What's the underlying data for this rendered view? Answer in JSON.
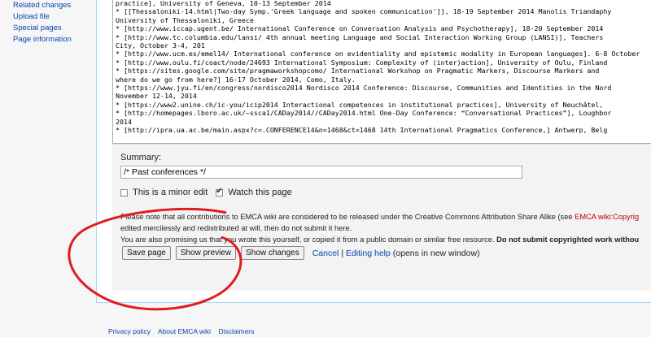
{
  "sidebar": {
    "items": [
      {
        "label": "Related changes"
      },
      {
        "label": "Upload file"
      },
      {
        "label": "Special pages"
      },
      {
        "label": "Page information"
      }
    ]
  },
  "editor": {
    "lines": [
      "practice], University of Geneva, 10-13 September 2014",
      "* [[Thessaloniki-14.html|Two-day Symp.'Greek language and spoken communication']], 18-19 September 2014 Manolis Triandaphy",
      "University of Thessaloniki, Greece",
      "* [http://www.iccap.ugent.be/ International Conference on Conversation Analysis and Psychotherapy], 18-20 September 2014",
      "* [http://www.tc.columbia.edu/lansi/ 4th annual meeting Language and Social Interaction Working Group (LANSI)], Teachers",
      "City, October 3-4, 201",
      "* [http://www.ucm.es/emel14/ International conference on evidentiality and epistemic modality in European languages]. 6-8 October",
      "* [http://www.oulu.fi/coact/node/24693 International Symposium: Complexity of (inter)action], University of Oulu, Finland",
      "* [https://sites.google.com/site/pragmaworkshopcomo/ International Workshop on Pragmatic Markers, Discourse Markers and",
      "where do we go from here?] 16-17 October 2014, Como, Italy.",
      "* [https://www.jyu.fi/en/congress/nordisco2014 Nordisco 2014 Conference: Discourse, Communities and Identities in the Nord",
      "November 12-14, 2014",
      "* [https://www2.unine.ch/ic-you/icip2014 Interactional competences in institutional practices], University of Neuchâtel,",
      "* [http://homepages.lboro.ac.uk/~ssca1/CADay2014//CADay2014.html One-Day Conference: “Conversational Practices”], Loughbor",
      "2014",
      "* [http://ipra.ua.ac.be/main.aspx?c=.CONFERENCE14&n=1468&ct=1468 14th International Pragmatics Conference,] Antwerp, Belg"
    ]
  },
  "summary": {
    "label": "Summary:",
    "value": "/* Past conferences */"
  },
  "options": {
    "minor_edit_label": "This is a minor edit",
    "watch_label": "Watch this page",
    "minor_edit_checked": false,
    "watch_checked": true
  },
  "notice": {
    "line1_pre": "Please note that all contributions to EMCA wiki are considered to be released under the Creative Commons Attribution Share Alike (see ",
    "line1_link": "EMCA wiki:Copyrig",
    "line2": "edited mercilessly and redistributed at will, then do not submit it here.",
    "line3_pre": "You are also promising us that you wrote this yourself, or copied it from a public domain or similar free resource. ",
    "line3_bold": "Do not submit copyrighted work withou"
  },
  "buttons": {
    "save": "Save page",
    "preview": "Show preview",
    "changes": "Show changes",
    "cancel": "Cancel",
    "separator": "|",
    "help": "Editing help",
    "help_suffix": "(opens in new window)"
  },
  "footer": {
    "privacy": "Privacy policy",
    "about": "About EMCA wiki",
    "disclaimers": "Disclaimers"
  },
  "colors": {
    "annotation": "#e01c1c",
    "link": "#0645ad",
    "redlink": "#ba0000"
  }
}
